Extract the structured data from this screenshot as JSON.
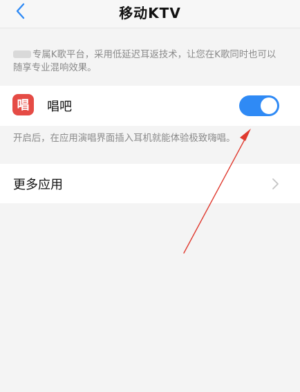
{
  "header": {
    "title": "移动KTV",
    "back_icon": "chevron-left-icon"
  },
  "description": "专属K歌平台，采用低延迟耳返技术，让您在K歌同时也可以随享专业混响效果。",
  "app": {
    "name": "唱吧",
    "icon_char": "唱",
    "icon_color": "#e54b45",
    "toggle_on": true,
    "toggle_color": "#2f8af5"
  },
  "hint": "开启后，在应用演唱界面插入耳机就能体验极致嗨唱。",
  "more": {
    "label": "更多应用",
    "icon": "chevron-right-icon"
  },
  "annotation": {
    "color": "#e03a2f"
  }
}
